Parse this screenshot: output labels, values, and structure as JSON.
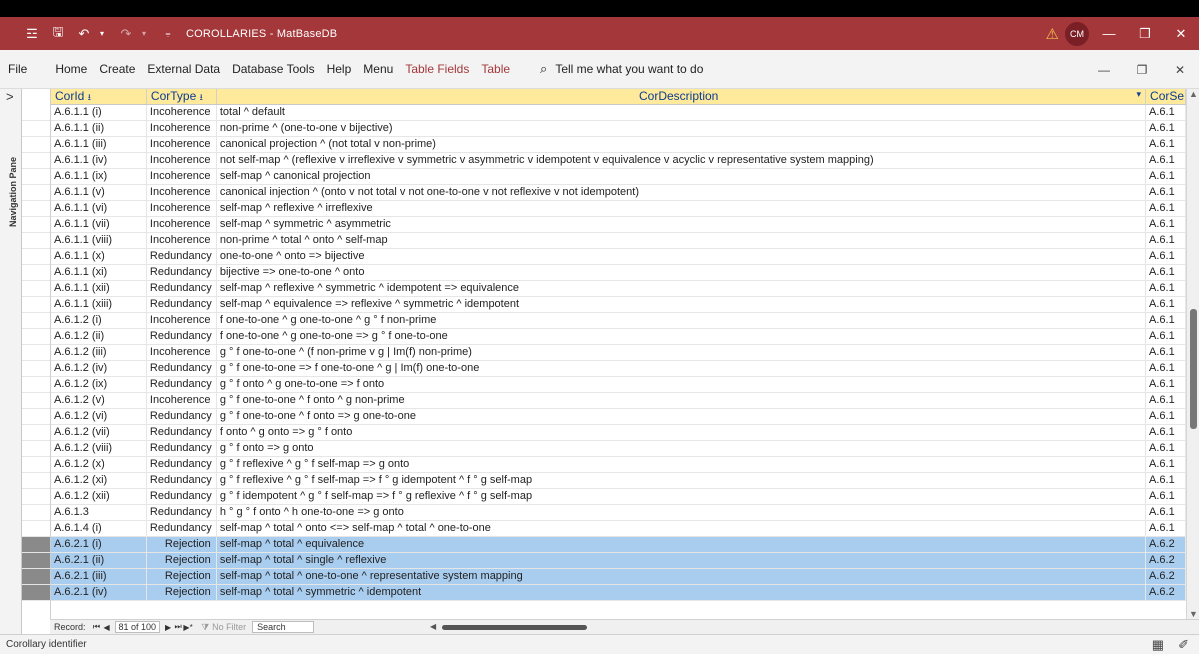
{
  "window": {
    "title": "COROLLARIES - MatBaseDB",
    "user_initials": "CM",
    "warning_icon": "warning-triangle-icon",
    "controls": {
      "minimize": "—",
      "restore": "❐",
      "close": "✕"
    }
  },
  "menu": {
    "items": [
      "File",
      "Home",
      "Create",
      "External Data",
      "Database Tools",
      "Help",
      "Menu"
    ],
    "context_items": [
      "Table Fields",
      "Table"
    ],
    "tell_me": "Tell me what you want to do",
    "right_controls": [
      "—",
      "❐",
      "✕"
    ]
  },
  "nav_pane": {
    "label": "Navigation Pane",
    "chevron": ">"
  },
  "table": {
    "columns": [
      "CorId",
      "CorType",
      "CorDescription",
      "CorSe"
    ],
    "rows": [
      [
        "A.6.1.1 (i)",
        "Incoherence",
        "total ^ default",
        "A.6.1"
      ],
      [
        "A.6.1.1 (ii)",
        "Incoherence",
        "non-prime ^ (one-to-one v bijective)",
        "A.6.1"
      ],
      [
        "A.6.1.1 (iii)",
        "Incoherence",
        "canonical projection ^ (not total v non-prime)",
        "A.6.1"
      ],
      [
        "A.6.1.1 (iv)",
        "Incoherence",
        "not self-map ^ (reflexive v irreflexive v symmetric v asymmetric v idempotent v equivalence v acyclic v representative system mapping)",
        "A.6.1"
      ],
      [
        "A.6.1.1 (ix)",
        "Incoherence",
        "self-map ^ canonical projection",
        "A.6.1"
      ],
      [
        "A.6.1.1 (v)",
        "Incoherence",
        "canonical injection ^ (onto v not total v not one-to-one v not reflexive v not idempotent)",
        "A.6.1"
      ],
      [
        "A.6.1.1 (vi)",
        "Incoherence",
        "self-map ^ reflexive ^ irreflexive",
        "A.6.1"
      ],
      [
        "A.6.1.1 (vii)",
        "Incoherence",
        "self-map ^ symmetric ^ asymmetric",
        "A.6.1"
      ],
      [
        "A.6.1.1 (viii)",
        "Incoherence",
        "non-prime ^ total ^ onto ^ self-map",
        "A.6.1"
      ],
      [
        "A.6.1.1 (x)",
        "Redundancy",
        "one-to-one ^ onto => bijective",
        "A.6.1"
      ],
      [
        "A.6.1.1 (xi)",
        "Redundancy",
        "bijective => one-to-one ^  onto",
        "A.6.1"
      ],
      [
        "A.6.1.1 (xii)",
        "Redundancy",
        "self-map ^ reflexive ^ symmetric ^ idempotent => equivalence",
        "A.6.1"
      ],
      [
        "A.6.1.1 (xiii)",
        "Redundancy",
        "self-map ^ equivalence => reflexive ^ symmetric ^ idempotent",
        "A.6.1"
      ],
      [
        "A.6.1.2 (i)",
        "Incoherence",
        "f one-to-one ^ g one-to-one ^ g ° f non-prime",
        "A.6.1"
      ],
      [
        "A.6.1.2 (ii)",
        "Redundancy",
        "f one-to-one ^ g one-to-one => g ° f one-to-one",
        "A.6.1"
      ],
      [
        "A.6.1.2 (iii)",
        "Incoherence",
        "g ° f one-to-one ^ (f non-prime v g | Im(f) non-prime)",
        "A.6.1"
      ],
      [
        "A.6.1.2 (iv)",
        "Redundancy",
        "g ° f one-to-one => f one-to-one ^ g | Im(f) one-to-one",
        "A.6.1"
      ],
      [
        "A.6.1.2 (ix)",
        "Redundancy",
        "g ° f onto ^ g one-to-one => f onto",
        "A.6.1"
      ],
      [
        "A.6.1.2 (v)",
        "Incoherence",
        "g ° f one-to-one ^ f onto ^ g non-prime",
        "A.6.1"
      ],
      [
        "A.6.1.2 (vi)",
        "Redundancy",
        "g ° f one-to-one ^ f onto => g one-to-one",
        "A.6.1"
      ],
      [
        "A.6.1.2 (vii)",
        "Redundancy",
        "f onto ^ g onto => g ° f onto",
        "A.6.1"
      ],
      [
        "A.6.1.2 (viii)",
        "Redundancy",
        "g ° f onto => g onto",
        "A.6.1"
      ],
      [
        "A.6.1.2 (x)",
        "Redundancy",
        "g ° f reflexive ^ g ° f self-map => g onto",
        "A.6.1"
      ],
      [
        "A.6.1.2 (xi)",
        "Redundancy",
        "g ° f reflexive ^ g ° f self-map => f ° g idempotent ^ f ° g self-map",
        "A.6.1"
      ],
      [
        "A.6.1.2 (xii)",
        "Redundancy",
        "g ° f idempotent ^ g ° f self-map => f ° g reflexive ^ f ° g self-map",
        "A.6.1"
      ],
      [
        "A.6.1.3",
        "Redundancy",
        "h ° g ° f onto ^ h one-to-one => g onto",
        "A.6.1"
      ],
      [
        "A.6.1.4 (i)",
        "Redundancy",
        "self-map ^ total ^ onto <=> self-map ^ total ^ one-to-one",
        "A.6.1"
      ],
      [
        "A.6.2.1 (i)",
        "Rejection",
        "self-map ^ total ^ equivalence",
        "A.6.2"
      ],
      [
        "A.6.2.1 (ii)",
        "Rejection",
        "self-map ^ total ^ single ^ reflexive",
        "A.6.2"
      ],
      [
        "A.6.2.1 (iii)",
        "Rejection",
        "self-map ^ total ^ one-to-one ^ representative system mapping",
        "A.6.2"
      ],
      [
        "A.6.2.1 (iv)",
        "Rejection",
        "self-map ^ total ^ symmetric ^ idempotent",
        "A.6.2"
      ]
    ],
    "selected_start": 27
  },
  "record_nav": {
    "label": "Record:",
    "position": "81 of 100",
    "no_filter": "No Filter",
    "search": "Search"
  },
  "status": {
    "text": "Corollary identifier"
  }
}
